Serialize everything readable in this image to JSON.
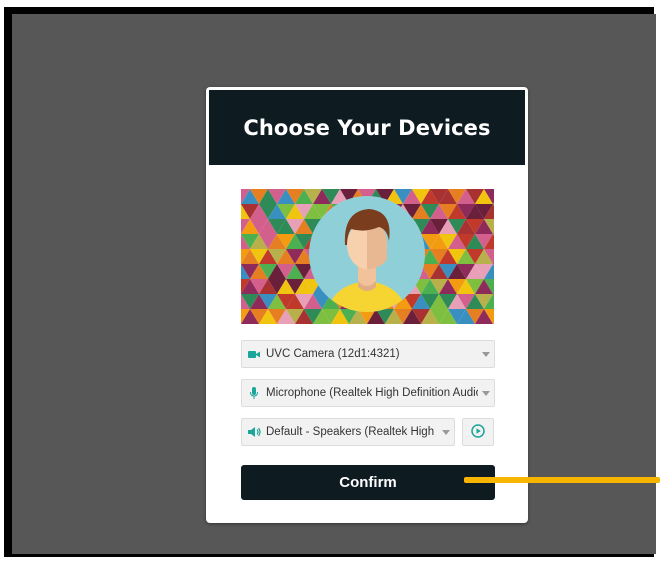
{
  "dialog": {
    "title": "Choose Your Devices",
    "confirm_label": "Confirm"
  },
  "devices": {
    "camera": {
      "value": "UVC Camera (12d1:4321)",
      "icon": "video-camera-icon"
    },
    "microphone": {
      "value": "Microphone (Realtek High Definition Audio)",
      "icon": "microphone-icon"
    },
    "speaker": {
      "value": "Default - Speakers (Realtek High Definition Audio)",
      "icon": "speaker-icon"
    }
  },
  "icons": {
    "play": "play-circle-icon",
    "dropdown": "chevron-down-icon"
  },
  "colors": {
    "header_bg": "#0e1b21",
    "button_bg": "#0e1b21",
    "accent": "#1aa69a",
    "backdrop": "#575757",
    "annotation_line": "#f7b500"
  }
}
